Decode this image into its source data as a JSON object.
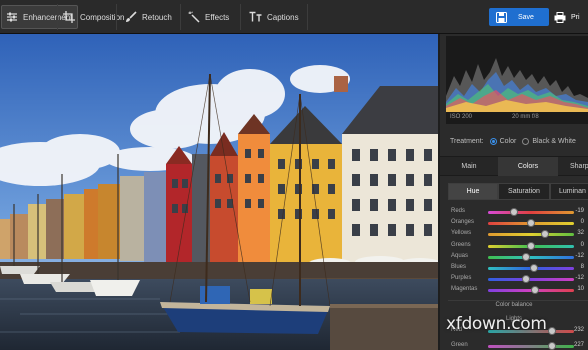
{
  "toolbar": {
    "tools": [
      {
        "label": "Enhancement",
        "icon": "sliders-icon",
        "active": true
      },
      {
        "label": "Composition",
        "icon": "crop-icon",
        "active": false
      },
      {
        "label": "Retouch",
        "icon": "brush-icon",
        "active": false
      },
      {
        "label": "Effects",
        "icon": "magic-wand-icon",
        "active": false
      },
      {
        "label": "Captions",
        "icon": "text-icon",
        "active": false
      }
    ],
    "save_label": "Save",
    "print_label": "Pri"
  },
  "histogram": {
    "iso": "ISO 200",
    "lens": "20 mm f/8"
  },
  "treatment": {
    "label": "Treatment:",
    "options": [
      "Color",
      "Black & White"
    ],
    "selected": "Color"
  },
  "tabs": [
    "Main",
    "Colors",
    "Sharp"
  ],
  "active_tab": "Colors",
  "subtabs": [
    "Hue",
    "Saturation",
    "Luminan"
  ],
  "active_subtab": "Hue",
  "hue_sliders": [
    {
      "name": "Reds",
      "value": "-19",
      "pos": 0.3
    },
    {
      "name": "Oranges",
      "value": "0",
      "pos": 0.5
    },
    {
      "name": "Yellows",
      "value": "32",
      "pos": 0.66
    },
    {
      "name": "Greens",
      "value": "0",
      "pos": 0.5
    },
    {
      "name": "Aquas",
      "value": "-12",
      "pos": 0.44
    },
    {
      "name": "Blues",
      "value": "8",
      "pos": 0.54
    },
    {
      "name": "Purples",
      "value": "-12",
      "pos": 0.44
    },
    {
      "name": "Magentas",
      "value": "10",
      "pos": 0.55
    }
  ],
  "color_balance": {
    "title": "Color balance",
    "lights_label": "Lights",
    "rows": [
      {
        "name": "Red",
        "value": "232"
      },
      {
        "name": "Green",
        "value": "227"
      }
    ]
  },
  "watermark": "xfdown.com",
  "colors": {
    "accent": "#1f6fd0",
    "panel_bg": "#2b2b2b",
    "toolbar_bg": "#2a2a2a"
  }
}
